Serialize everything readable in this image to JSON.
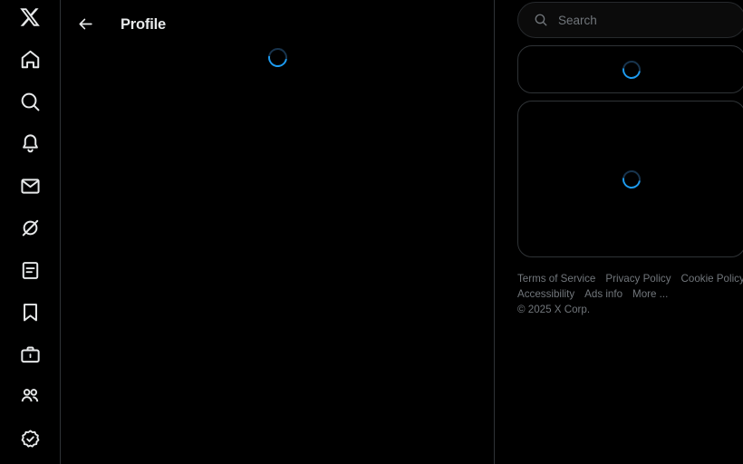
{
  "nav_rail": {
    "logo": {
      "name": "x-logo",
      "label": "X"
    },
    "items": [
      {
        "icon": "home-icon",
        "label": "Home"
      },
      {
        "icon": "search-icon",
        "label": "Explore"
      },
      {
        "icon": "bell-icon",
        "label": "Notifications"
      },
      {
        "icon": "envelope-icon",
        "label": "Messages"
      },
      {
        "icon": "grok-icon",
        "label": "Grok"
      },
      {
        "icon": "list-icon",
        "label": "Lists"
      },
      {
        "icon": "bookmark-icon",
        "label": "Bookmarks"
      },
      {
        "icon": "briefcase-icon",
        "label": "Jobs"
      },
      {
        "icon": "communities-icon",
        "label": "Communities"
      },
      {
        "icon": "verified-icon",
        "label": "Premium"
      }
    ]
  },
  "main": {
    "back_icon": "arrow-left-icon",
    "title": "Profile",
    "loading": true
  },
  "aside": {
    "search": {
      "icon": "search-icon",
      "placeholder": "Search",
      "value": ""
    },
    "cards": [
      {
        "name": "sidebar-card-small",
        "loading": true
      },
      {
        "name": "sidebar-card-large",
        "loading": true
      }
    ],
    "footer": {
      "links": [
        "Terms of Service",
        "Privacy Policy",
        "Cookie Policy",
        "Accessibility",
        "Ads info",
        "More ..."
      ],
      "copyright": "© 2025 X Corp."
    }
  },
  "colors": {
    "background": "#000000",
    "border": "#2f3336",
    "text_primary": "#e7e9ea",
    "text_secondary": "#71767b",
    "accent": "#1d9bf0",
    "spinner_track": "#18344d"
  }
}
